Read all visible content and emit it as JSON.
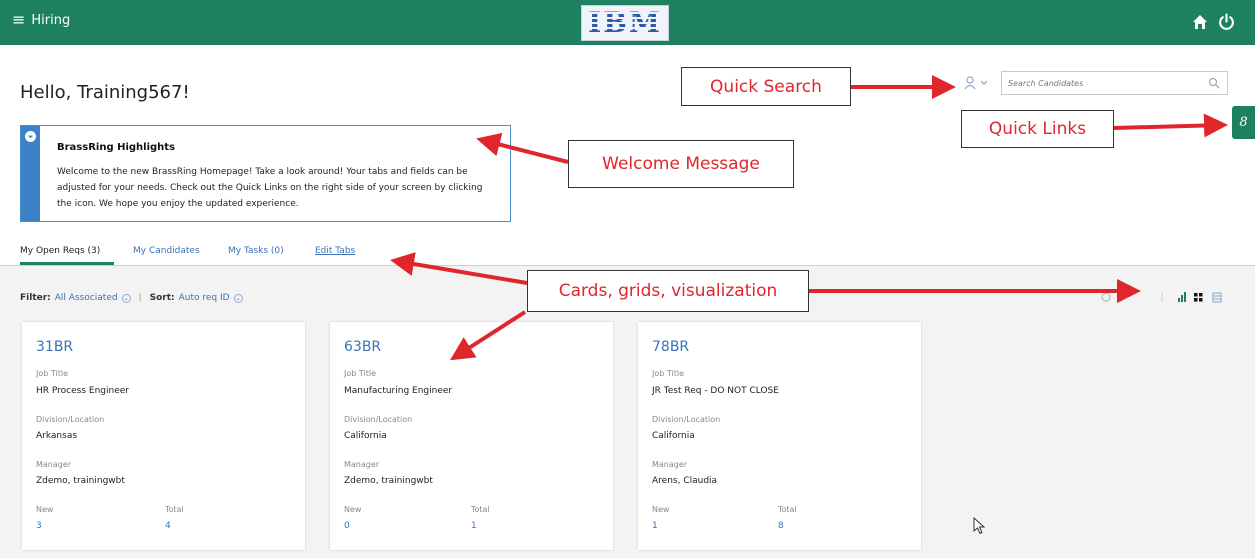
{
  "header": {
    "menu_label": "Hiring",
    "logo_text": "IBM",
    "brand_color": "#1d8060"
  },
  "greeting": "Hello, Training567!",
  "highlight": {
    "title": "BrassRing Highlights",
    "body": "Welcome to the new BrassRing Homepage!  Take a look around!  Your tabs and fields can be adjusted for your needs.  Check out the Quick Links on the right side of your screen by clicking the icon.  We hope you enjoy the updated experience.",
    "close_glyph": "×"
  },
  "search": {
    "placeholder": "Search Candidates"
  },
  "quicklinks_glyph": "8",
  "tabs": [
    {
      "label": "My Open Reqs (3)",
      "active": true
    },
    {
      "label": "My Candidates",
      "active": false
    },
    {
      "label": "My Tasks (0)",
      "active": false
    },
    {
      "label": "Edit Tabs",
      "active": false
    }
  ],
  "filter": {
    "filter_label": "Filter:",
    "filter_value": "All Associated",
    "separator": "|",
    "sort_label": "Sort:",
    "sort_value": "Auto req ID"
  },
  "card_labels": {
    "job_title": "Job Title",
    "division": "Division/Location",
    "manager": "Manager",
    "new": "New",
    "total": "Total"
  },
  "cards": [
    {
      "id": "31BR",
      "job_title": "HR Process Engineer",
      "division": "Arkansas",
      "manager": "Zdemo, trainingwbt",
      "new": "3",
      "total": "4"
    },
    {
      "id": "63BR",
      "job_title": "Manufacturing Engineer",
      "division": "California",
      "manager": "Zdemo, trainingwbt",
      "new": "0",
      "total": "1"
    },
    {
      "id": "78BR",
      "job_title": "JR Test Req - DO NOT CLOSE",
      "division": "California",
      "manager": "Arens, Claudia",
      "new": "1",
      "total": "8"
    }
  ],
  "annotations": {
    "quick_search": "Quick Search",
    "quick_links": "Quick Links",
    "welcome": "Welcome Message",
    "cards": "Cards, grids, visualization",
    "color": "#e0262d"
  },
  "icons": [
    "menu-icon",
    "home-icon",
    "power-icon",
    "persona-icon",
    "search-icon",
    "info-icon",
    "chart-view-icon",
    "card-view-icon",
    "list-view-icon",
    "cursor-icon"
  ]
}
